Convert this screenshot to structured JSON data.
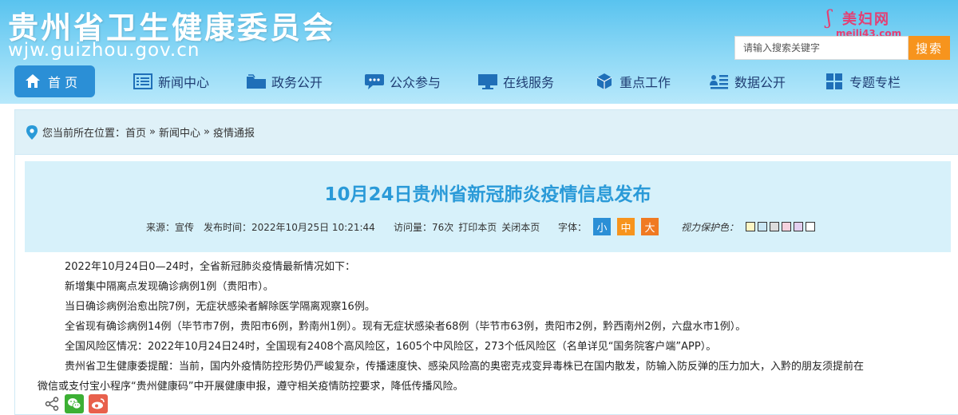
{
  "header": {
    "title": "贵州省卫生健康委员会",
    "domain": "wjw.guizhou.gov.cn",
    "watermark_text": "美妇网",
    "watermark_url": "meili43.com",
    "search_placeholder": "请输入搜索关键字",
    "search_label": "搜索"
  },
  "nav": {
    "items": [
      {
        "label": "首 页",
        "icon": "home-icon"
      },
      {
        "label": "新闻中心",
        "icon": "news-list-icon"
      },
      {
        "label": "政务公开",
        "icon": "folder-icon"
      },
      {
        "label": "公众参与",
        "icon": "chat-icon"
      },
      {
        "label": "在线服务",
        "icon": "monitor-icon"
      },
      {
        "label": "重点工作",
        "icon": "cube-icon"
      },
      {
        "label": "数据公开",
        "icon": "user-list-icon"
      },
      {
        "label": "专题专栏",
        "icon": "grid-icon"
      }
    ]
  },
  "breadcrumb": {
    "prefix": "您当前所在位置：",
    "items": [
      "首页",
      "新闻中心",
      "疫情通报"
    ],
    "separator": "»"
  },
  "article": {
    "title": "10月24日贵州省新冠肺炎疫情信息发布",
    "source": "来源：宣传",
    "publish_time": "发布时间：2022年10月25日 10:21:44",
    "visits": "访问量：76次",
    "print": "打印本页",
    "close": "关闭本页",
    "font_label": "字体：",
    "font_small": "小",
    "font_mid": "中",
    "font_large": "大",
    "eye_label": "视力保护色：",
    "eye_colors": [
      "#fdf6c4",
      "#c9e6f4",
      "#dcdcdc",
      "#f5d2de",
      "#e3d0f0",
      "#ffffff"
    ],
    "paragraphs": [
      "2022年10月24日0—24时，全省新冠肺炎疫情最新情况如下：",
      "新增集中隔离点发现确诊病例1例（贵阳市）。",
      "当日确诊病例治愈出院7例，无症状感染者解除医学隔离观察16例。",
      "全省现有确诊病例14例（毕节市7例，贵阳市6例，黔南州1例）。现有无症状感染者68例（毕节市63例，贵阳市2例，黔西南州2例，六盘水市1例）。",
      "全国风险区情况：2022年10月24日24时，全国现有2408个高风险区，1605个中风险区，273个低风险区（名单详见“国务院客户端”APP）。",
      "贵州省卫生健康委提醒：当前，国内外疫情防控形势仍严峻复杂，传播速度快、感染风险高的奥密克戎变异毒株已在国内散发，防输入防反弹的压力加大，入黔的朋友须提前在",
      "微信或支付宝小程序“贵州健康码”中开展健康申报，遵守相关疫情防控要求，降低传播风险。"
    ]
  },
  "colors": {
    "header_top": "#59c3ef",
    "nav_active": "#2b8fd6",
    "search_button": "#f7941d",
    "title_blue": "#2a9ad8",
    "nav_text": "#1f3d73"
  }
}
